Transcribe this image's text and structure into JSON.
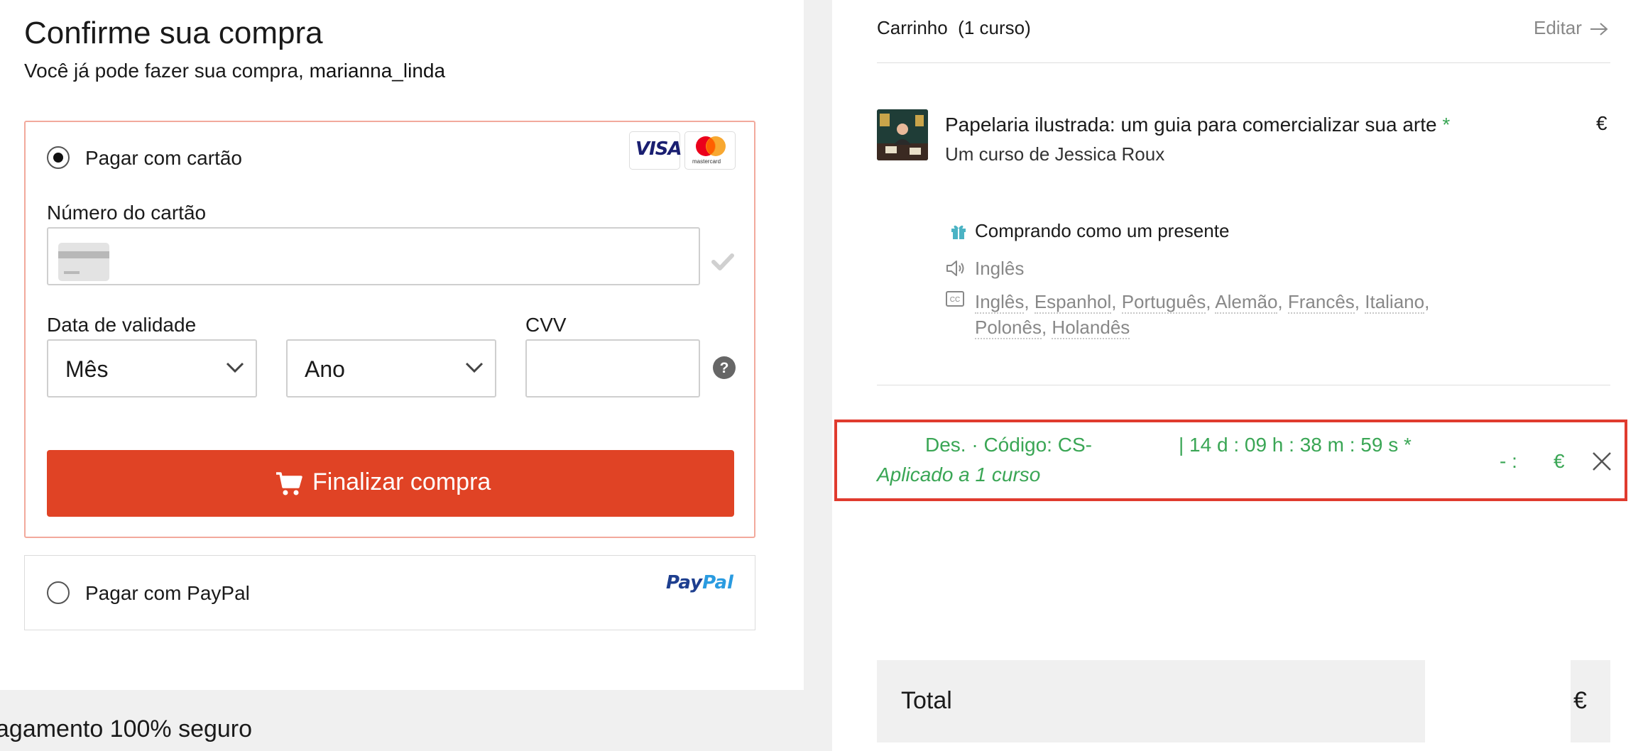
{
  "header": {
    "title": "Confirme sua compra",
    "subtitle_prefix": "Você já pode fazer sua compra,",
    "username": "marianna_linda"
  },
  "payment": {
    "card_option_label": "Pagar com cartão",
    "card_option_selected": true,
    "card_brands": [
      "VISA",
      "mastercard"
    ],
    "card_number_label": "Número do cartão",
    "card_number_value": "",
    "expiry_label": "Data de validade",
    "month_selected": "Mês",
    "year_selected": "Ano",
    "cvv_label": "CVV",
    "cvv_value": "",
    "submit_label": "Finalizar compra",
    "paypal_option_label": "Pagar com PayPal",
    "paypal_option_selected": false,
    "paypal_logo_pay": "Pay",
    "paypal_logo_pal": "Pal"
  },
  "footer": {
    "secure_text": "agamento 100% seguro"
  },
  "cart": {
    "title": "Carrinho",
    "count_text": "(1 curso)",
    "edit_label": "Editar",
    "course": {
      "title": "Papelaria ilustrada: um guia para comercializar sua arte",
      "title_mark": "*",
      "author": "Um curso de Jessica Roux",
      "price_symbol": "€",
      "gift_text": "Comprando como um presente",
      "audio_language": "Inglês",
      "subtitles": [
        "Inglês",
        "Espanhol",
        "Português",
        "Alemão",
        "Francês",
        "Italiano",
        "Polonês",
        "Holandês"
      ]
    },
    "discount": {
      "code_text": "Des. · Código: CS-",
      "countdown": "| 14 d : 09 h : 38 m : 59 s *",
      "applied_text": "Aplicado a 1 curso",
      "amount_prefix": "- :",
      "currency": "€"
    },
    "total": {
      "label": "Total",
      "currency": "€"
    }
  },
  "colors": {
    "accent": "#e04325",
    "discount_green": "#3aa655",
    "highlight_border": "#e03b2e",
    "panel_border": "#f2a99c"
  }
}
